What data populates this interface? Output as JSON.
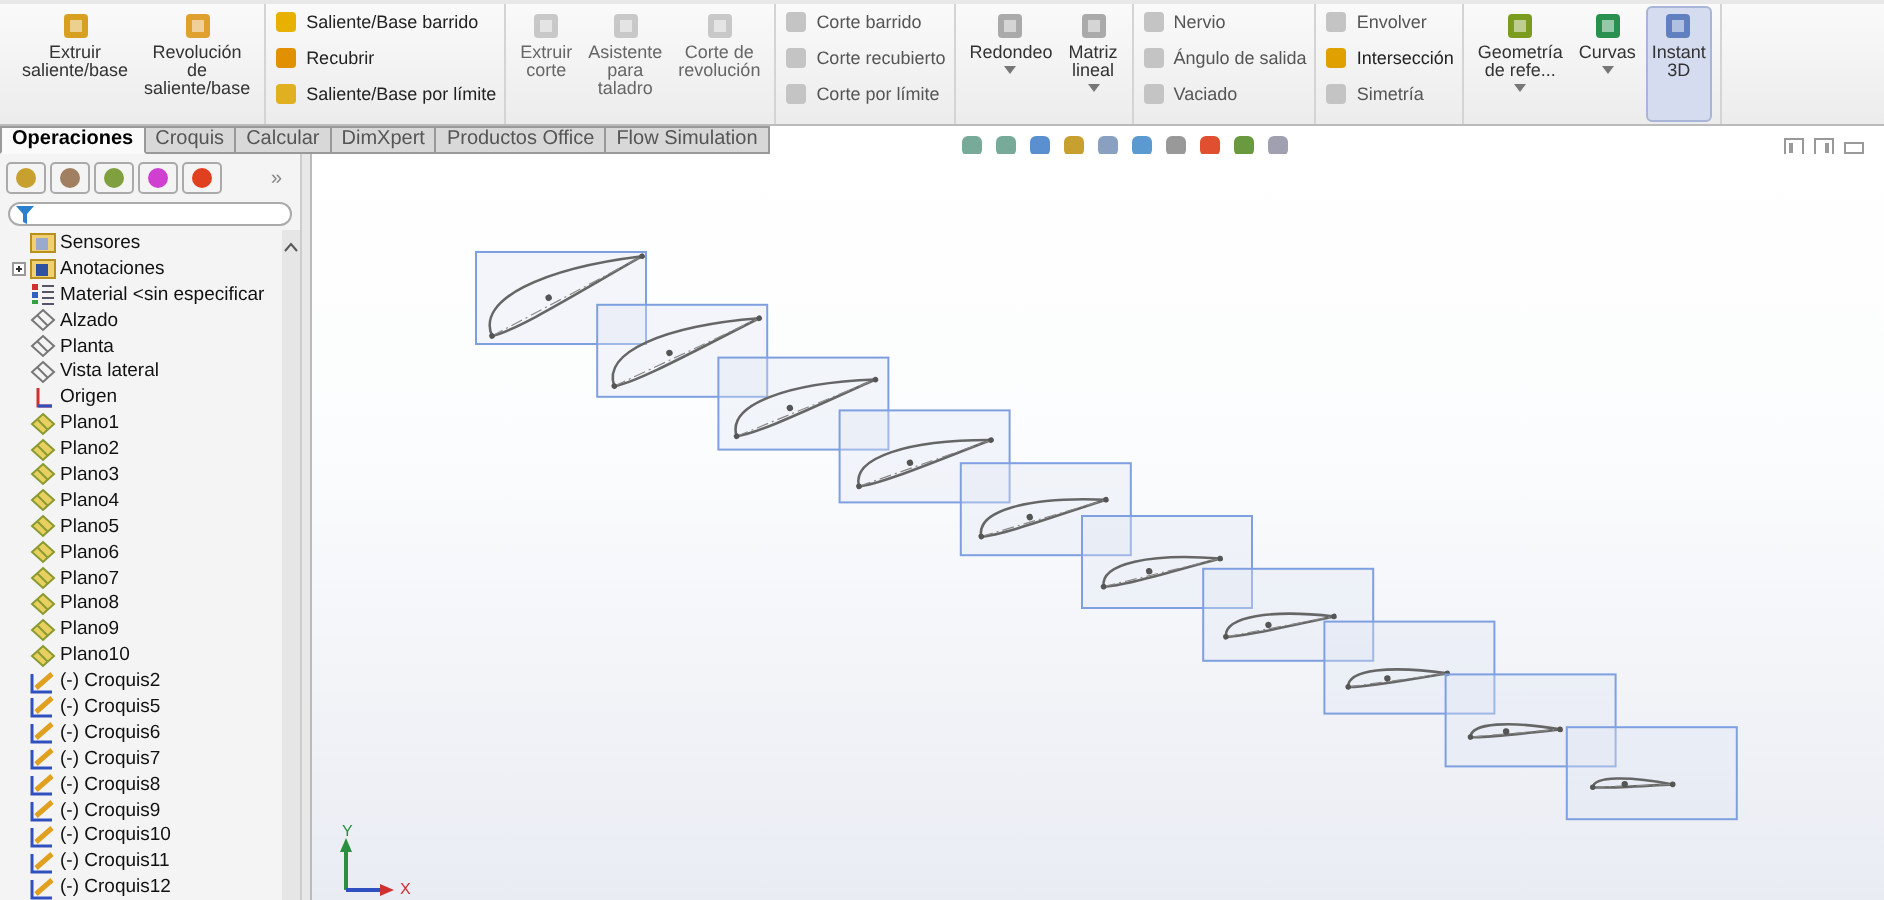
{
  "ribbon": {
    "groups": [
      {
        "kind": "large",
        "items": [
          {
            "label": "Extruir saliente/base",
            "disabled": false,
            "active": false,
            "dropdown": false
          },
          {
            "label": "Revolución de saliente/base",
            "disabled": false,
            "active": false,
            "dropdown": false
          }
        ]
      },
      {
        "kind": "stack",
        "items": [
          {
            "label": "Saliente/Base barrido",
            "disabled": false
          },
          {
            "label": "Recubrir",
            "disabled": false
          },
          {
            "label": "Saliente/Base por límite",
            "disabled": false
          }
        ]
      },
      {
        "kind": "large",
        "items": [
          {
            "label": "Extruir corte",
            "disabled": true,
            "active": false,
            "dropdown": false
          },
          {
            "label": "Asistente para taladro",
            "disabled": true,
            "active": false,
            "dropdown": false
          },
          {
            "label": "Corte de revolución",
            "disabled": true,
            "active": false,
            "dropdown": false
          }
        ]
      },
      {
        "kind": "stack",
        "items": [
          {
            "label": "Corte barrido",
            "disabled": true
          },
          {
            "label": "Corte recubierto",
            "disabled": true
          },
          {
            "label": "Corte por límite",
            "disabled": true
          }
        ]
      },
      {
        "kind": "large",
        "items": [
          {
            "label": "Redondeo",
            "disabled": false,
            "active": false,
            "dropdown": true
          },
          {
            "label": "Matriz lineal",
            "disabled": false,
            "active": false,
            "dropdown": true
          }
        ]
      },
      {
        "kind": "stack",
        "items": [
          {
            "label": "Nervio",
            "disabled": true
          },
          {
            "label": "Ángulo de salida",
            "disabled": true
          },
          {
            "label": "Vaciado",
            "disabled": true
          }
        ]
      },
      {
        "kind": "stack",
        "items": [
          {
            "label": "Envolver",
            "disabled": true
          },
          {
            "label": "Intersección",
            "disabled": false
          },
          {
            "label": "Simetría",
            "disabled": true
          }
        ]
      },
      {
        "kind": "large",
        "items": [
          {
            "label": "Geometría de refe...",
            "disabled": false,
            "active": false,
            "dropdown": true
          },
          {
            "label": "Curvas",
            "disabled": false,
            "active": false,
            "dropdown": true
          },
          {
            "label": "Instant 3D",
            "disabled": false,
            "active": true,
            "dropdown": false
          }
        ]
      }
    ]
  },
  "tabs": [
    {
      "label": "Operaciones",
      "selected": true
    },
    {
      "label": "Croquis",
      "selected": false
    },
    {
      "label": "Calcular",
      "selected": false
    },
    {
      "label": "DimXpert",
      "selected": false
    },
    {
      "label": "Productos Office",
      "selected": false
    },
    {
      "label": "Flow Simulation",
      "selected": false
    }
  ],
  "panel": {
    "more": "»",
    "tree": [
      {
        "label": "Sensores",
        "kind": "sensors"
      },
      {
        "label": "Anotaciones",
        "kind": "annotations"
      },
      {
        "label": "Material <sin especificar",
        "kind": "material"
      },
      {
        "label": "Alzado",
        "kind": "std-plane"
      },
      {
        "label": "Planta",
        "kind": "std-plane"
      },
      {
        "label": "Vista lateral",
        "kind": "std-plane"
      },
      {
        "label": "Origen",
        "kind": "origin"
      },
      {
        "label": "Plano1",
        "kind": "plane"
      },
      {
        "label": "Plano2",
        "kind": "plane"
      },
      {
        "label": "Plano3",
        "kind": "plane"
      },
      {
        "label": "Plano4",
        "kind": "plane"
      },
      {
        "label": "Plano5",
        "kind": "plane"
      },
      {
        "label": "Plano6",
        "kind": "plane"
      },
      {
        "label": "Plano7",
        "kind": "plane"
      },
      {
        "label": "Plano8",
        "kind": "plane"
      },
      {
        "label": "Plano9",
        "kind": "plane"
      },
      {
        "label": "Plano10",
        "kind": "plane"
      },
      {
        "label": "(-) Croquis2",
        "kind": "sketch"
      },
      {
        "label": "(-) Croquis5",
        "kind": "sketch"
      },
      {
        "label": "(-) Croquis6",
        "kind": "sketch"
      },
      {
        "label": "(-) Croquis7",
        "kind": "sketch"
      },
      {
        "label": "(-) Croquis8",
        "kind": "sketch"
      },
      {
        "label": "(-) Croquis9",
        "kind": "sketch"
      },
      {
        "label": "(-) Croquis10",
        "kind": "sketch"
      },
      {
        "label": "(-) Croquis11",
        "kind": "sketch"
      },
      {
        "label": "(-) Croquis12",
        "kind": "sketch"
      }
    ]
  },
  "viewport": {
    "axes": {
      "x": "X",
      "y": "Y"
    }
  }
}
